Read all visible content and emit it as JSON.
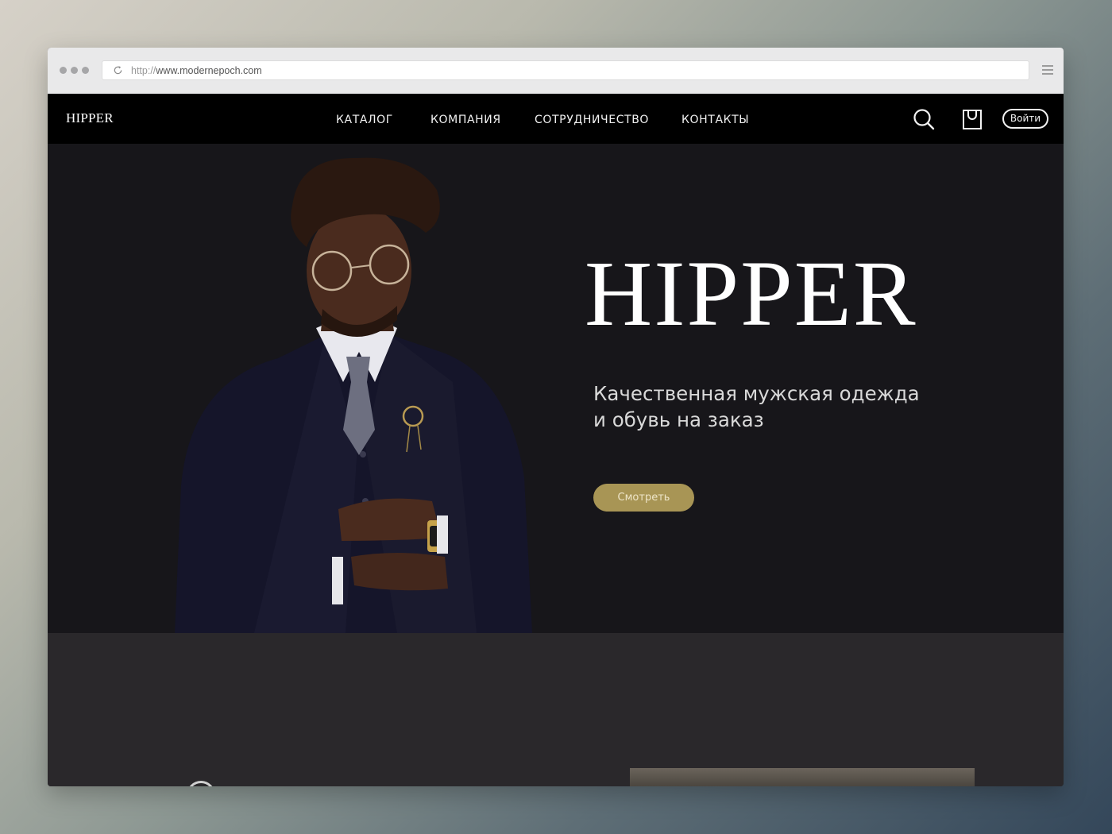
{
  "browser": {
    "url_protocol": "http://",
    "url_host": "www.modernepoch.com"
  },
  "nav": {
    "logo": "HIPPER",
    "links": [
      "Каталог",
      "Компания",
      "Сотрудничество",
      "Контакты"
    ],
    "login_label": "Войти",
    "icons": [
      "search-icon",
      "shopping-bag-icon"
    ]
  },
  "hero": {
    "title": "HIPPER",
    "subtitle_line1": "Качественная мужская одежда",
    "subtitle_line2": "и обувь на заказ",
    "cta_label": "Смотреть"
  },
  "colors": {
    "nav_bg": "#000000",
    "hero_bg": "#17161a",
    "section_bg": "#2a282b",
    "accent": "#a89555"
  }
}
